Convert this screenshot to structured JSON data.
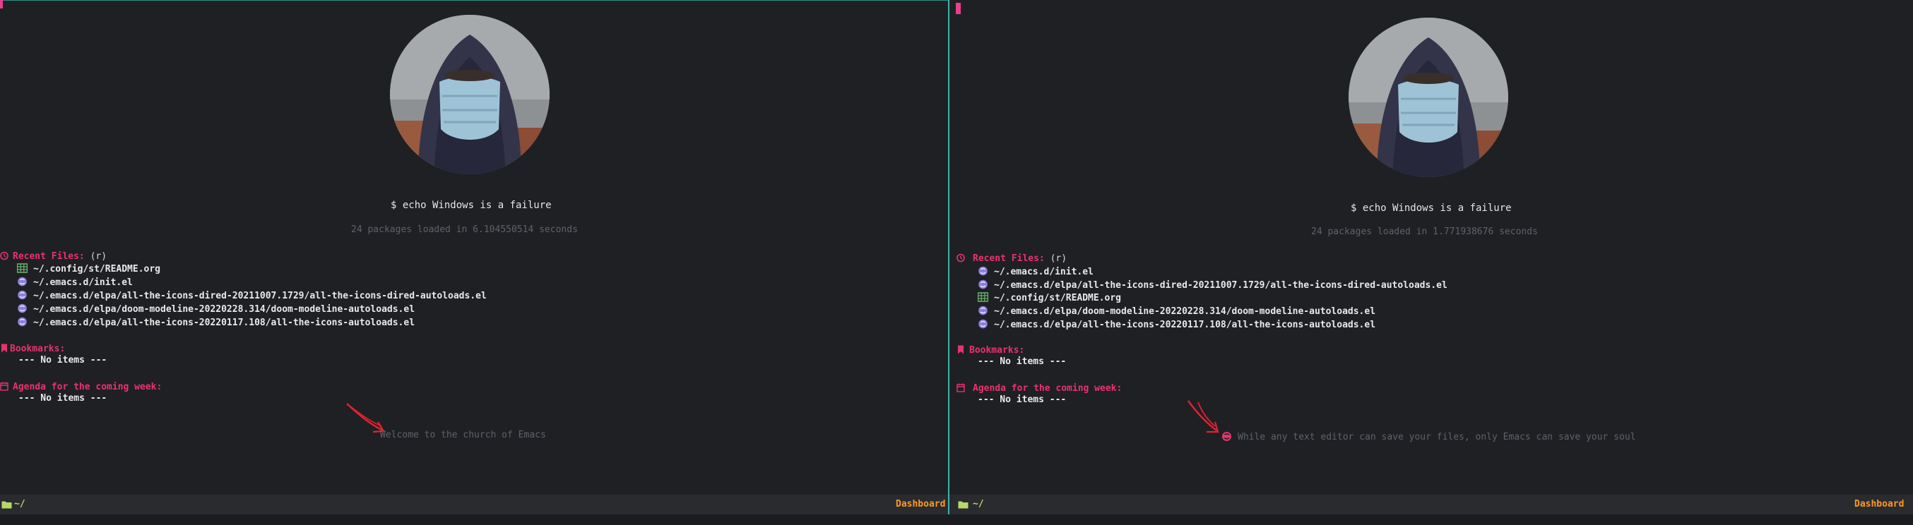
{
  "colors": {
    "accent_pink": "#e8336e",
    "modeline_orange": "#ff9a1f",
    "modeline_green": "#b9d86a",
    "dim_text": "#5e6268",
    "icon_purple": "#8b7fdc",
    "icon_green": "#6bb56f",
    "divider_teal": "#3fb3a8"
  },
  "left_pane": {
    "banner": "$ echo Windows is a failure",
    "loaded": "24 packages loaded in 6.104550514 seconds",
    "recent": {
      "title": "Recent Files:",
      "key": "(r)",
      "items": [
        {
          "icon": "table-icon",
          "path": "~/.config/st/README.org"
        },
        {
          "icon": "elisp-icon",
          "path": "~/.emacs.d/init.el"
        },
        {
          "icon": "elisp-icon",
          "path": "~/.emacs.d/elpa/all-the-icons-dired-20211007.1729/all-the-icons-dired-autoloads.el"
        },
        {
          "icon": "elisp-icon",
          "path": "~/.emacs.d/elpa/doom-modeline-20220228.314/doom-modeline-autoloads.el"
        },
        {
          "icon": "elisp-icon",
          "path": "~/.emacs.d/elpa/all-the-icons-20220117.108/all-the-icons-autoloads.el"
        }
      ]
    },
    "bookmarks": {
      "title": "Bookmarks:",
      "empty": "--- No items ---"
    },
    "agenda": {
      "title": "Agenda for the coming week:",
      "empty": "--- No items ---"
    },
    "footer": "Welcome to the church of Emacs",
    "modeline": {
      "path": "~/",
      "mode": "Dashboard"
    }
  },
  "right_pane": {
    "banner": "$ echo Windows is a failure",
    "loaded": "24 packages loaded in 1.771938676 seconds",
    "recent": {
      "title": "Recent Files:",
      "key": "(r)",
      "items": [
        {
          "icon": "elisp-icon",
          "path": "~/.emacs.d/init.el"
        },
        {
          "icon": "elisp-icon",
          "path": "~/.emacs.d/elpa/all-the-icons-dired-20211007.1729/all-the-icons-dired-autoloads.el"
        },
        {
          "icon": "table-icon",
          "path": "~/.config/st/README.org"
        },
        {
          "icon": "elisp-icon",
          "path": "~/.emacs.d/elpa/doom-modeline-20220228.314/doom-modeline-autoloads.el"
        },
        {
          "icon": "elisp-icon",
          "path": "~/.emacs.d/elpa/all-the-icons-20220117.108/all-the-icons-autoloads.el"
        }
      ]
    },
    "bookmarks": {
      "title": "Bookmarks:",
      "empty": "--- No items ---"
    },
    "agenda": {
      "title": "Agenda for the coming week:",
      "empty": "--- No items ---"
    },
    "footer": "While any text editor can save your files, only Emacs can save your soul",
    "modeline": {
      "path": "~/",
      "mode": "Dashboard"
    }
  }
}
